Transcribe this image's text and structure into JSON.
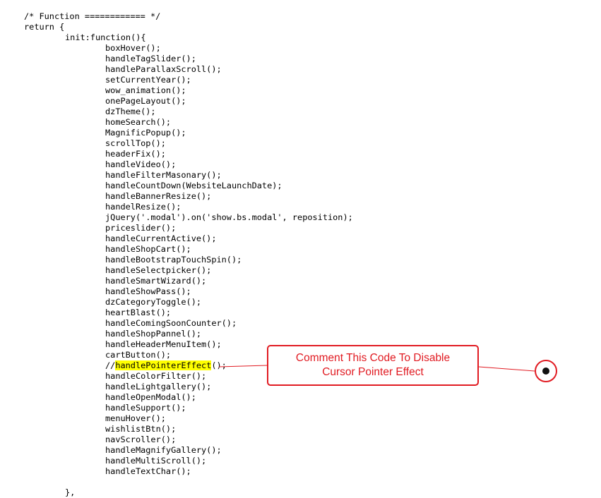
{
  "code": {
    "lines": [
      {
        "indent": 1,
        "text": "/* Function ============ */"
      },
      {
        "indent": 1,
        "text": "return {"
      },
      {
        "indent": 2,
        "text": "init:function(){"
      },
      {
        "indent": 3,
        "text": "boxHover();"
      },
      {
        "indent": 3,
        "text": "handleTagSlider();"
      },
      {
        "indent": 3,
        "text": "handleParallaxScroll();"
      },
      {
        "indent": 3,
        "text": "setCurrentYear();"
      },
      {
        "indent": 3,
        "text": "wow_animation();"
      },
      {
        "indent": 3,
        "text": "onePageLayout();"
      },
      {
        "indent": 3,
        "text": "dzTheme();"
      },
      {
        "indent": 3,
        "text": "homeSearch();"
      },
      {
        "indent": 3,
        "text": "MagnificPopup();"
      },
      {
        "indent": 3,
        "text": "scrollTop();"
      },
      {
        "indent": 3,
        "text": "headerFix();"
      },
      {
        "indent": 3,
        "text": "handleVideo();"
      },
      {
        "indent": 3,
        "text": "handleFilterMasonary();"
      },
      {
        "indent": 3,
        "text": "handleCountDown(WebsiteLaunchDate);"
      },
      {
        "indent": 3,
        "text": "handleBannerResize();"
      },
      {
        "indent": 3,
        "text": "handelResize();"
      },
      {
        "indent": 3,
        "text": "jQuery('.modal').on('show.bs.modal', reposition);"
      },
      {
        "indent": 3,
        "text": "priceslider();"
      },
      {
        "indent": 3,
        "text": "handleCurrentActive();"
      },
      {
        "indent": 3,
        "text": "handleShopCart();"
      },
      {
        "indent": 3,
        "text": "handleBootstrapTouchSpin();"
      },
      {
        "indent": 3,
        "text": "handleSelectpicker();"
      },
      {
        "indent": 3,
        "text": "handleSmartWizard();"
      },
      {
        "indent": 3,
        "text": "handleShowPass();"
      },
      {
        "indent": 3,
        "text": "dzCategoryToggle();"
      },
      {
        "indent": 3,
        "text": "heartBlast();"
      },
      {
        "indent": 3,
        "text": "handleComingSoonCounter();"
      },
      {
        "indent": 3,
        "text": "handleShopPannel();"
      },
      {
        "indent": 3,
        "text": "handleHeaderMenuItem();"
      },
      {
        "indent": 3,
        "text": "cartButton();"
      },
      {
        "indent": 3,
        "text": "",
        "prefix": "//",
        "highlight": "handlePointerEffect",
        "suffix": "();"
      },
      {
        "indent": 3,
        "text": "handleColorFilter();"
      },
      {
        "indent": 3,
        "text": "handleLightgallery();"
      },
      {
        "indent": 3,
        "text": "handleOpenModal();"
      },
      {
        "indent": 3,
        "text": "handleSupport();"
      },
      {
        "indent": 3,
        "text": "menuHover();"
      },
      {
        "indent": 3,
        "text": "wishlistBtn();"
      },
      {
        "indent": 3,
        "text": "navScroller();"
      },
      {
        "indent": 3,
        "text": "handleMagnifyGallery();"
      },
      {
        "indent": 3,
        "text": "handleMultiScroll();"
      },
      {
        "indent": 3,
        "text": "handleTextChar();"
      },
      {
        "indent": 0,
        "text": ""
      },
      {
        "indent": 2,
        "text": "},"
      }
    ]
  },
  "callout": {
    "line1": "Comment This Code To Disable",
    "line2": "Cursor Pointer Effect"
  },
  "colors": {
    "accent": "#e11b22",
    "highlight": "#ffff00",
    "text": "#000000"
  },
  "icons": {
    "marker": "target-marker-icon"
  }
}
